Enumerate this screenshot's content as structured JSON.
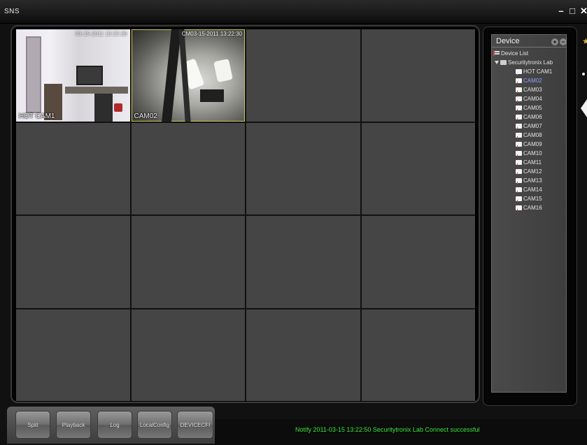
{
  "window": {
    "title": "SNS",
    "minimize": "–",
    "maximize": "□",
    "close": "✕"
  },
  "grid": {
    "cells": [
      {
        "label": "HOT CAM1",
        "timestamp": "03-15-2011 13:22:28",
        "feed": "room"
      },
      {
        "label": "CAM02",
        "timestamp": "CM03-15-2011 13:22:30",
        "feed": "interior",
        "selected": true
      },
      {
        "label": ""
      },
      {
        "label": ""
      },
      {
        "label": ""
      },
      {
        "label": ""
      },
      {
        "label": ""
      },
      {
        "label": ""
      },
      {
        "label": ""
      },
      {
        "label": ""
      },
      {
        "label": ""
      },
      {
        "label": ""
      },
      {
        "label": ""
      },
      {
        "label": ""
      },
      {
        "label": ""
      },
      {
        "label": ""
      }
    ]
  },
  "device_panel": {
    "title": "Device",
    "add_icon": "plus-icon",
    "remove_icon": "minus-icon",
    "tree": {
      "root": "Device List",
      "site": "Securitytronix Lab",
      "cameras": [
        "HOT CAM1",
        "CAM02",
        "CAM03",
        "CAM04",
        "CAM05",
        "CAM06",
        "CAM07",
        "CAM08",
        "CAM09",
        "CAM10",
        "CAM11",
        "CAM12",
        "CAM13",
        "CAM14",
        "CAM15",
        "CAM16"
      ],
      "active_camera": "CAM02"
    }
  },
  "toolbar": {
    "split": "Split",
    "playback": "Playback",
    "log": "Log",
    "localconfig": "LocalConfig",
    "devicecfg": "DEVICECFI"
  },
  "status": {
    "text": "Notify  2011-03-15  13:22:50  Securitytronix Lab  Connect successful",
    "color": "#38e438"
  }
}
